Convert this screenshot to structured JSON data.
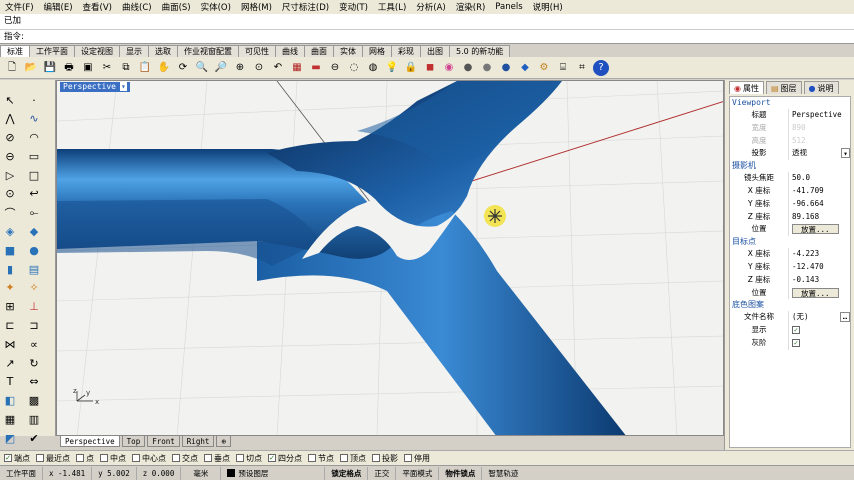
{
  "menu": [
    "文件(F)",
    "编辑(E)",
    "查看(V)",
    "曲线(C)",
    "曲面(S)",
    "实体(O)",
    "网格(M)",
    "尺寸标注(D)",
    "变动(T)",
    "工具(L)",
    "分析(A)",
    "渲染(R)",
    "Panels",
    "说明(H)"
  ],
  "command": {
    "history": "已加",
    "prompt": "指令:"
  },
  "toolbar_tabs": [
    "标准",
    "工作平面",
    "设定视图",
    "显示",
    "选取",
    "作业视窗配置",
    "可见性",
    "曲线",
    "曲面",
    "实体",
    "网格",
    "彩现",
    "出图",
    "5.0 的新功能"
  ],
  "viewport": {
    "label": "Perspective",
    "arrow": "▾"
  },
  "viewport_tabs": [
    "Perspective",
    "Top",
    "Front",
    "Right",
    "⊕"
  ],
  "panel": {
    "tabs": [
      "属性",
      "图层",
      "说明"
    ],
    "viewport_section": "Viewport",
    "title_key": "标题",
    "title_val": "Perspective",
    "width_key": "宽度",
    "width_val": "890",
    "height_key": "高度",
    "height_val": "512",
    "proj_key": "投影",
    "proj_val": "透视",
    "camera_section": "摄影机",
    "focal_key": "镜头焦距",
    "focal_val": "50.0",
    "cx_key": "X 座标",
    "cx_val": "-41.709",
    "cy_key": "Y 座标",
    "cy_val": "-96.664",
    "cz_key": "Z 座标",
    "cz_val": "89.168",
    "pos_key": "位置",
    "place_label": "放置...",
    "target_section": "目标点",
    "tx_key": "X 座标",
    "tx_val": "-4.223",
    "ty_key": "Y 座标",
    "ty_val": "-12.470",
    "tz_key": "Z 座标",
    "tz_val": "-0.143",
    "tpos_key": "位置",
    "wallpaper_section": "底色图案",
    "file_key": "文件名称",
    "file_val": "(无)",
    "show_key": "显示",
    "gray_key": "灰阶"
  },
  "snaps": [
    {
      "label": "端点",
      "checked": true
    },
    {
      "label": "最近点",
      "checked": false
    },
    {
      "label": "点",
      "checked": false
    },
    {
      "label": "中点",
      "checked": false
    },
    {
      "label": "中心点",
      "checked": false
    },
    {
      "label": "交点",
      "checked": false
    },
    {
      "label": "垂点",
      "checked": false
    },
    {
      "label": "切点",
      "checked": false
    },
    {
      "label": "四分点",
      "checked": true
    },
    {
      "label": "节点",
      "checked": false
    },
    {
      "label": "顶点",
      "checked": false
    },
    {
      "label": "投影",
      "checked": false
    },
    {
      "label": "停用",
      "checked": false
    }
  ],
  "status": {
    "cplane": "工作平面",
    "x": "x -1.481",
    "y": "y 5.002",
    "z": "z 0.000",
    "unit": "毫米",
    "layer": "预设图层",
    "gridsnap": "锁定格点",
    "ortho": "正交",
    "planar": "平面模式",
    "osnap": "物件锁点",
    "smarttrack": "智慧轨迹"
  },
  "colors": {
    "pipe": "#2a72b8",
    "vp_label": "#3a6fc4",
    "grid": "#d8d8d6",
    "axis_red": "#b03030"
  }
}
